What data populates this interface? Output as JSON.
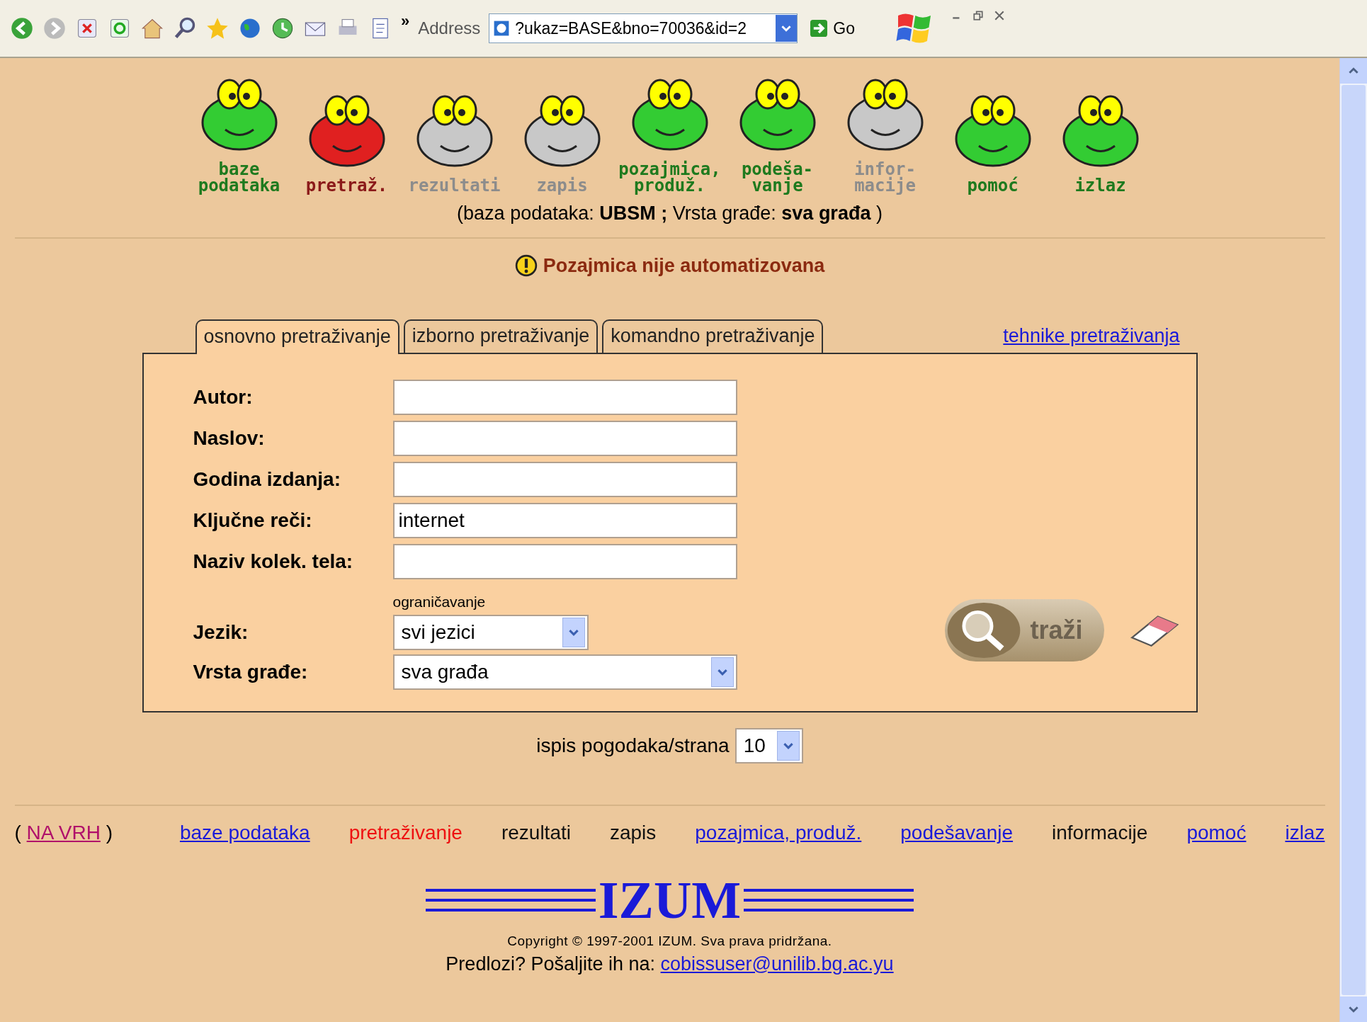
{
  "browser": {
    "chevron": "»",
    "address_label": "Address",
    "address": "?ukaz=BASE&bno=70036&id=2",
    "go": "Go"
  },
  "nav": [
    {
      "lines": [
        "baze",
        "podataka"
      ],
      "kind": "link"
    },
    {
      "lines": [
        "pretraž."
      ],
      "kind": "current"
    },
    {
      "lines": [
        "rezultati"
      ],
      "kind": "disabled"
    },
    {
      "lines": [
        "zapis"
      ],
      "kind": "disabled"
    },
    {
      "lines": [
        "pozajmica,",
        "produž."
      ],
      "kind": "link"
    },
    {
      "lines": [
        "podeša-",
        "vanje"
      ],
      "kind": "link"
    },
    {
      "lines": [
        "infor-",
        "macije"
      ],
      "kind": "disabled"
    },
    {
      "lines": [
        "pomoć"
      ],
      "kind": "link"
    },
    {
      "lines": [
        "izlaz"
      ],
      "kind": "link"
    }
  ],
  "context": "(baza podataka: **UBSM ;** Vrsta građe: **sva građa** )",
  "notice": "Pozajmica nije automatizovana",
  "tabs": [
    {
      "label": "osnovno pretraživanje",
      "selected": true
    },
    {
      "label": "izborno pretraživanje",
      "selected": false
    },
    {
      "label": "komandno pretraživanje",
      "selected": false
    }
  ],
  "help_link": "tehnike pretraživanja",
  "fields": [
    {
      "label": "Autor:"
    },
    {
      "label": "Naslov:"
    },
    {
      "label": "Godina izdanja:"
    },
    {
      "label": "Ključne reči:",
      "value": "internet"
    },
    {
      "label": "Naziv kolek. tela:"
    }
  ],
  "limit_heading": "ograničavanje",
  "selects": [
    {
      "label": "Jezik:",
      "value": "svi jezici",
      "kind": "short"
    },
    {
      "label": "Vrsta građe:",
      "value": "sva građa",
      "kind": "long"
    }
  ],
  "search_button": "traži",
  "per_page": {
    "label": "ispis pogodaka/strana",
    "value": "10"
  },
  "footer": {
    "open": "(",
    "top_link": "NA VRH",
    "close": ")",
    "links": [
      {
        "label": "baze podataka",
        "kind": "link"
      },
      {
        "label": "pretraživanje",
        "kind": "current"
      },
      {
        "label": "rezultati",
        "kind": "plain"
      },
      {
        "label": "zapis",
        "kind": "plain"
      },
      {
        "label": "pozajmica, produž.",
        "kind": "link"
      },
      {
        "label": "podešavanje",
        "kind": "link"
      },
      {
        "label": "informacije",
        "kind": "plain"
      },
      {
        "label": "pomoć",
        "kind": "link"
      },
      {
        "label": "izlaz",
        "kind": "link"
      }
    ]
  },
  "logo": "IZUM",
  "copyright": "Copyright © 1997-2001 IZUM. Sva prava pridržana.",
  "contact": {
    "text": "Predlozi? Pošaljite ih na:",
    "email": "cobissuser@unilib.bg.ac.yu"
  }
}
